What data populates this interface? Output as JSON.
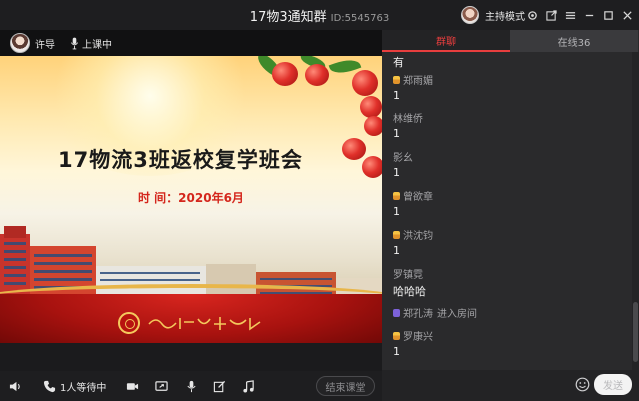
{
  "window": {
    "title": "17物3通知群",
    "room_id": "ID:5545763",
    "host_mode_label": "主持模式"
  },
  "stage": {
    "teacher_name": "许导",
    "status": "上课中"
  },
  "slide": {
    "title": "17物流3班返校复学班会",
    "subtitle": "时  间：2020年6月"
  },
  "toolbar": {
    "waiting": "1人等待中",
    "end_button": "结束课堂"
  },
  "chat": {
    "tabs": [
      {
        "label": "群聊"
      },
      {
        "label": "在线36"
      }
    ],
    "messages": [
      {
        "sender": "",
        "text": "有"
      },
      {
        "sender": "郑雨媚",
        "text": "1",
        "badge": "user"
      },
      {
        "sender": "林维侨",
        "text": "1",
        "badge": "none"
      },
      {
        "sender": "影幺",
        "text": "1",
        "badge": "none"
      },
      {
        "sender": "曾欲章",
        "text": "1",
        "badge": "user"
      },
      {
        "sender": "洪沈钧",
        "text": "1",
        "badge": "user"
      },
      {
        "sender": "罗镇霓",
        "text": "哈哈哈",
        "badge": "none"
      },
      {
        "sender": "郑孔涛",
        "text": "进入房间",
        "badge": "system"
      },
      {
        "sender": "罗康兴",
        "text": "1",
        "badge": "user"
      }
    ],
    "input_placeholder": "",
    "send_label": "发送"
  },
  "colors": {
    "accent": "#e83e3e",
    "panel_bg": "#2a2a2c",
    "toolbar_bg": "#1e1e20"
  },
  "icons": [
    "settings-icon",
    "popout-icon",
    "menu-icon",
    "minimize-icon",
    "maximize-icon",
    "close-icon",
    "microphone-icon",
    "volume-icon",
    "phone-icon",
    "camera-icon",
    "screen-share-icon",
    "mic-icon",
    "edit-icon",
    "music-icon",
    "emoji-icon"
  ]
}
